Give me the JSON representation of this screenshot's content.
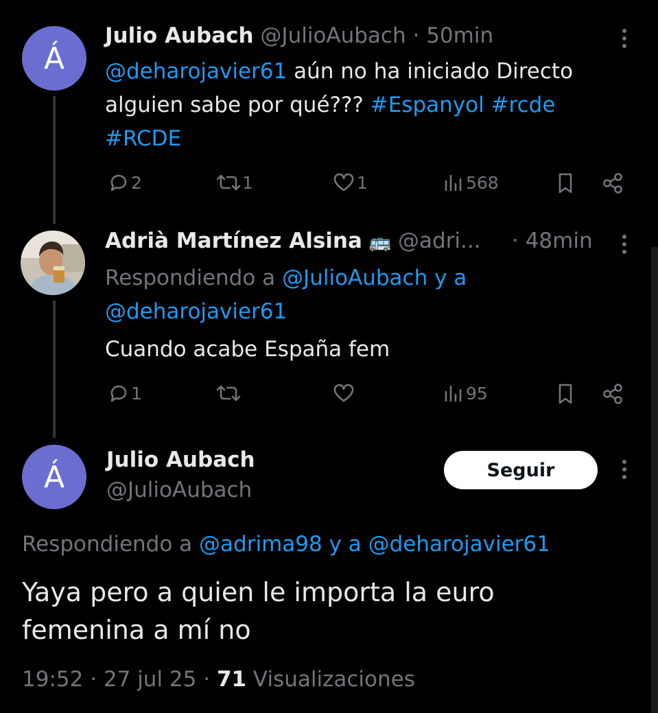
{
  "tweet1": {
    "avatar_letter": "Á",
    "name": "Julio Aubach",
    "handle": "@JulioAubach",
    "time": "· 50min",
    "mention": "@deharojavier61",
    "text_a": " aún no ha iniciado Directo alguien sabe por qué??? ",
    "hashtag1": "#Espanyol",
    "hashtag2": "#rcde",
    "hashtag3": "#RCDE",
    "replies": "2",
    "retweets": "1",
    "likes": "1",
    "views": "568"
  },
  "tweet2": {
    "name": "Adrià Martínez Alsina",
    "bus_emoji": "🚌",
    "handle": "@adri...",
    "time": "· 48min",
    "replying_prefix": "Respondiendo a ",
    "replying_user1": "@JulioAubach y a",
    "replying_user2": "@deharojavier61",
    "text": "Cuando acabe España fem",
    "replies": "1",
    "views": "95"
  },
  "main_tweet": {
    "avatar_letter": "Á",
    "name": "Julio Aubach",
    "handle": "@JulioAubach",
    "follow_label": "Seguir",
    "replying_prefix": "Respondiendo a ",
    "replying_users": "@adrima98 y a @deharojavier61",
    "text_line1": "Yaya pero a quien le importa la euro",
    "text_line2": "femenina a mí no",
    "timestamp": "19:52 · 27 jul 25 · ",
    "views_count": "71",
    "views_label": " Visualizaciones"
  },
  "colors": {
    "background": "#000000",
    "link": "#1d9bf0",
    "muted": "#71767b",
    "avatar": "#6b6ed0"
  }
}
